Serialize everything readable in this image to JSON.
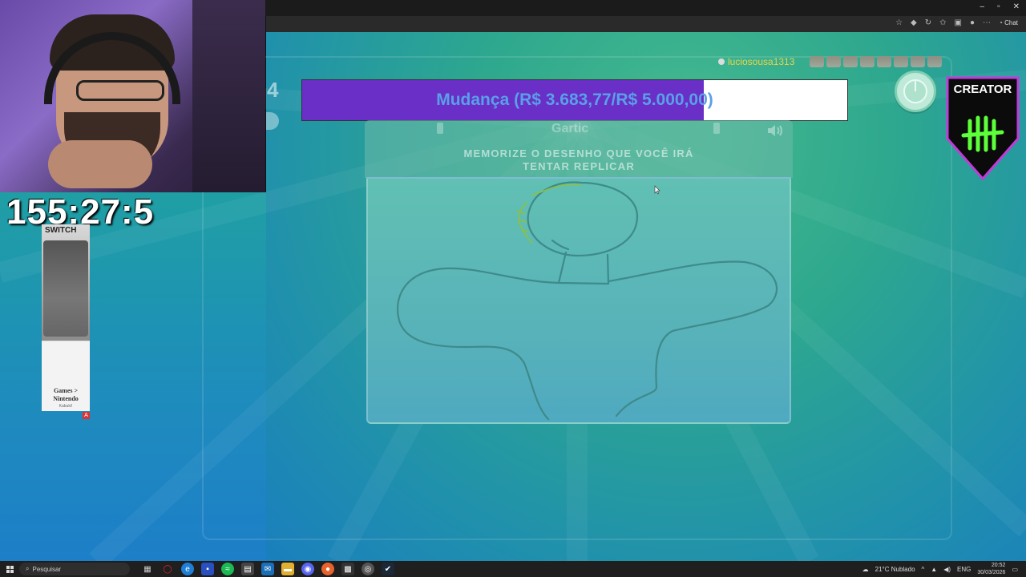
{
  "browser": {
    "controls": [
      "–",
      "▫",
      "✕"
    ],
    "chat_label": "Chat"
  },
  "game": {
    "round_number": "4",
    "donation": {
      "text": "Mudança (R$ 3.683,77/R$ 5.000,00)",
      "progress": 0.737,
      "fill_color": "#6a2fc6",
      "text_color": "#5aa0e8"
    },
    "player_name": "luciosousa1313",
    "avatar_count": 8,
    "logo_text": "Gartic",
    "instruction_line1": "MEMORIZE O DESENHO QUE VOCÊ IRÁ",
    "instruction_line2": "TENTAR REPLICAR",
    "creator_badge": "CREATOR"
  },
  "overlay": {
    "stream_timer": "155:27:5",
    "switch_label": "SWITCH",
    "promo_line1": "Games >",
    "promo_line2": "Nintendo",
    "promo_sub": "Kabuki!",
    "promo_badge": "A"
  },
  "taskbar": {
    "search_placeholder": "Pesquisar",
    "weather": "21°C  Nublado",
    "language": "ENG",
    "time": "20:52",
    "date": "30/03/2026"
  }
}
